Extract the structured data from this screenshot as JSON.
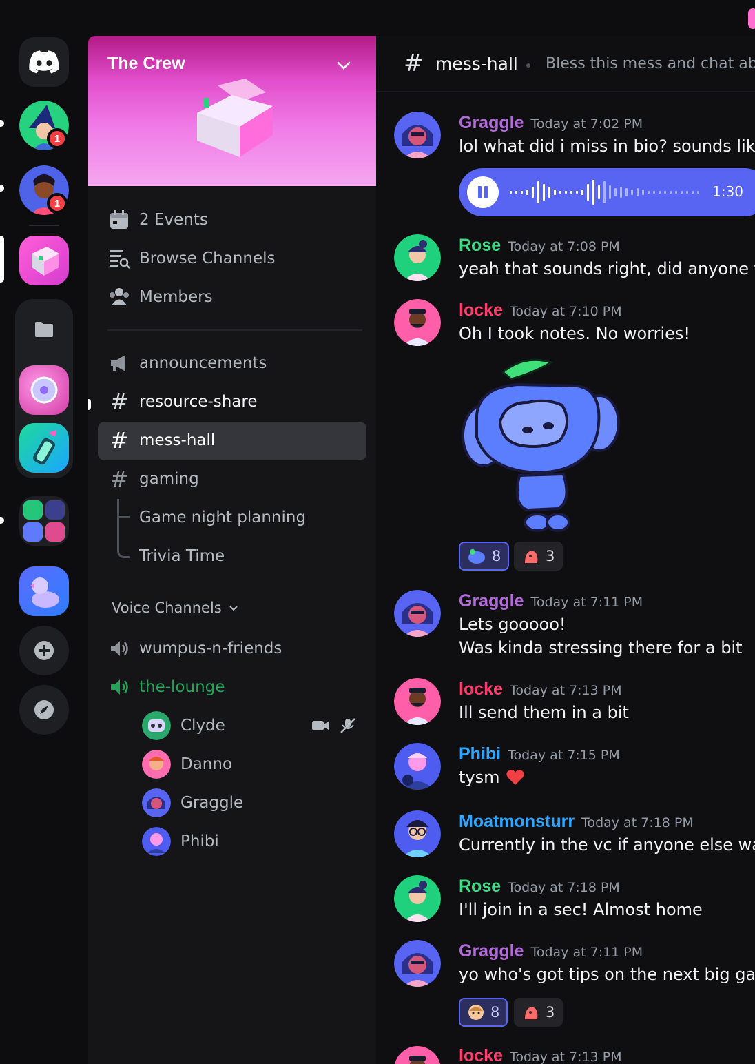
{
  "server": {
    "name": "The Crew"
  },
  "rail": {
    "badges": [
      "1",
      "1"
    ]
  },
  "sidebar": {
    "links": [
      {
        "label": "2 Events",
        "icon": "calendar-icon"
      },
      {
        "label": "Browse Channels",
        "icon": "browse-channels-icon"
      },
      {
        "label": "Members",
        "icon": "members-icon"
      }
    ],
    "channels": [
      {
        "label": "announcements",
        "icon": "megaphone-icon"
      },
      {
        "label": "resource-share",
        "icon": "hash-icon"
      },
      {
        "label": "mess-hall",
        "icon": "hash-icon",
        "active": true
      },
      {
        "label": "gaming",
        "icon": "hash-icon"
      }
    ],
    "threads": [
      "Game night planning",
      "Trivia Time"
    ],
    "voice_header": "Voice Channels",
    "voice_channels": [
      {
        "label": "wumpus-n-friends",
        "icon": "speaker-icon"
      },
      {
        "label": "the-lounge",
        "icon": "speaker-icon",
        "active": true
      }
    ],
    "voice_users": [
      "Clyde",
      "Danno",
      "Graggle",
      "Phibi"
    ]
  },
  "chat": {
    "channel": "mess-hall",
    "topic": "Bless this mess and chat about",
    "voice_message_duration": "1:30",
    "messages": [
      {
        "author": "Graggle",
        "time": "Today at 7:02 PM",
        "lines": [
          "lol what did i miss in bio? sounds like..."
        ]
      },
      {
        "author": "Rose",
        "time": "Today at 7:08 PM",
        "lines": [
          "yeah that sounds right, did anyone tak"
        ]
      },
      {
        "author": "locke",
        "time": "Today at 7:10 PM",
        "lines": [
          "Oh I took notes. No worries!"
        ],
        "reactions": [
          "8",
          "3"
        ]
      },
      {
        "author": "Graggle",
        "time": "Today at 7:11 PM",
        "lines": [
          "Lets gooooo!",
          "Was kinda stressing there for a bit"
        ]
      },
      {
        "author": "locke",
        "time": "Today at 7:13 PM",
        "lines": [
          "Ill send them in a bit"
        ]
      },
      {
        "author": "Phibi",
        "time": "Today at 7:15 PM",
        "lines": [
          "tysm"
        ]
      },
      {
        "author": "Moatmonsturr",
        "time": "Today at 7:18 PM",
        "lines": [
          "Currently in the vc if anyone else want"
        ]
      },
      {
        "author": "Rose",
        "time": "Today at 7:18 PM",
        "lines": [
          "I'll join in a sec! Almost home"
        ]
      },
      {
        "author": "Graggle",
        "time": "Today at 7:11 PM",
        "lines": [
          "yo who's got tips on the next big game"
        ],
        "reactions": [
          "8",
          "3"
        ]
      },
      {
        "author": "locke",
        "time": "Today at 7:13 PM",
        "lines": []
      }
    ]
  },
  "colors": {
    "graggle": "#b36ad9",
    "rose": "#3ddc84",
    "locke": "#ff3d6e",
    "phibi": "#2fa7ff",
    "moatmonsturr": "#2fa7ff",
    "voice_active": "#23a559",
    "blurple": "#5865f2"
  }
}
